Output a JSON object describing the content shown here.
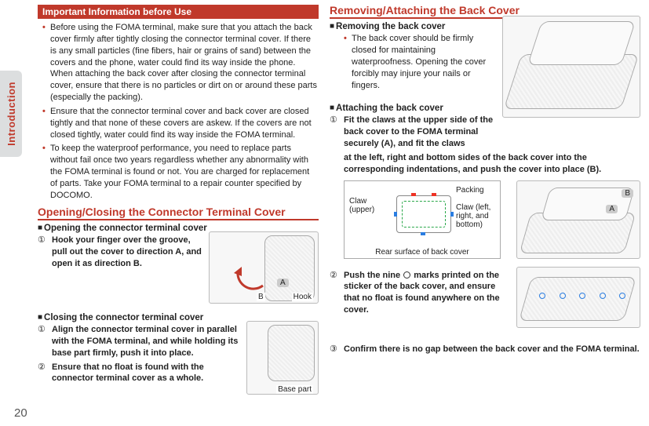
{
  "side_tab": "Introduction",
  "page_number": "20",
  "left": {
    "info_heading": "Important Information before Use",
    "info_bullets": [
      "Before using the FOMA terminal, make sure that you attach the back cover firmly after tightly closing the connector terminal cover. If there is any small particles (fine fibers, hair or grains of sand) between the covers and the phone, water could find its way inside the phone. When attaching the back cover after closing the connector terminal cover, ensure that there is no particles or dirt on or around these parts (especially the packing).",
      "Ensure that the connector terminal cover and back cover are closed tightly and that none of these covers are askew. If the covers are not closed tightly, water could find its way inside the FOMA terminal.",
      "To keep the waterproof performance, you need to replace parts without fail once two years regardless whether any abnormality with the FOMA terminal is found or not. You are charged for replacement of parts. Take your FOMA terminal to a repair counter specified by DOCOMO."
    ],
    "open_close_title": "Opening/Closing the Connector Terminal Cover",
    "opening_sub": "Opening the connector terminal cover",
    "opening_step_num": "①",
    "opening_step": "Hook your finger over the groove, pull out the cover to direction A, and open it as direction B.",
    "hook_label": "Hook",
    "a_label": "A",
    "b_label": "B",
    "closing_sub": "Closing the connector terminal cover",
    "closing_step1_num": "①",
    "closing_step1": "Align the connector terminal cover in parallel with the FOMA terminal, and while holding its base part firmly, push it into place.",
    "closing_step2_num": "②",
    "closing_step2": "Ensure that no float is found with the connector terminal cover as a whole.",
    "base_part": "Base part"
  },
  "right": {
    "title": "Removing/Attaching the Back Cover",
    "removing_sub": "Removing the back cover",
    "removing_bullet": "The back cover should be firmly closed for maintaining waterproofness. Opening the cover forcibly may injure your nails or fingers.",
    "attaching_sub": "Attaching the back cover",
    "step1_num": "①",
    "step1a": "Fit the claws at the upper side of the back cover to the FOMA terminal securely (A), and fit the claws",
    "step1b": "at the left, right and bottom sides of the back cover into the corresponding indentations, and push the cover into place (B).",
    "diagram": {
      "claw_upper": "Claw (upper)",
      "packing": "Packing",
      "claw_sides": "Claw (left, right, and bottom)",
      "footer": "Rear surface of back cover",
      "a": "A",
      "b": "B"
    },
    "step2_num": "②",
    "step2": "Push the nine ◯ marks printed on the sticker of the back cover, and ensure that no float is found anywhere on the cover.",
    "step3_num": "③",
    "step3": "Confirm there is no gap between the back cover and the FOMA terminal."
  }
}
